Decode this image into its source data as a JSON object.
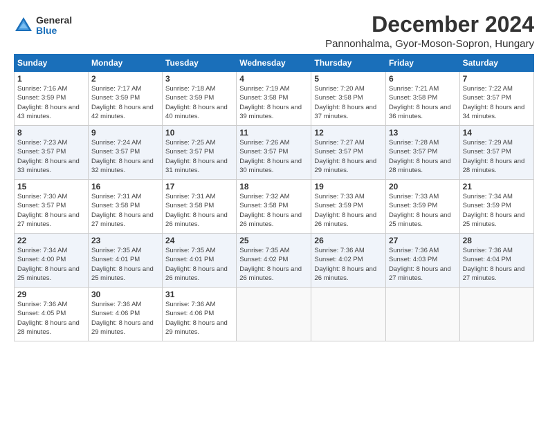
{
  "logo": {
    "general": "General",
    "blue": "Blue"
  },
  "title": "December 2024",
  "subtitle": "Pannonhalma, Gyor-Moson-Sopron, Hungary",
  "days_of_week": [
    "Sunday",
    "Monday",
    "Tuesday",
    "Wednesday",
    "Thursday",
    "Friday",
    "Saturday"
  ],
  "weeks": [
    [
      {
        "day": "1",
        "sunrise": "7:16 AM",
        "sunset": "3:59 PM",
        "daylight": "8 hours and 43 minutes."
      },
      {
        "day": "2",
        "sunrise": "7:17 AM",
        "sunset": "3:59 PM",
        "daylight": "8 hours and 42 minutes."
      },
      {
        "day": "3",
        "sunrise": "7:18 AM",
        "sunset": "3:59 PM",
        "daylight": "8 hours and 40 minutes."
      },
      {
        "day": "4",
        "sunrise": "7:19 AM",
        "sunset": "3:58 PM",
        "daylight": "8 hours and 39 minutes."
      },
      {
        "day": "5",
        "sunrise": "7:20 AM",
        "sunset": "3:58 PM",
        "daylight": "8 hours and 37 minutes."
      },
      {
        "day": "6",
        "sunrise": "7:21 AM",
        "sunset": "3:58 PM",
        "daylight": "8 hours and 36 minutes."
      },
      {
        "day": "7",
        "sunrise": "7:22 AM",
        "sunset": "3:57 PM",
        "daylight": "8 hours and 34 minutes."
      }
    ],
    [
      {
        "day": "8",
        "sunrise": "7:23 AM",
        "sunset": "3:57 PM",
        "daylight": "8 hours and 33 minutes."
      },
      {
        "day": "9",
        "sunrise": "7:24 AM",
        "sunset": "3:57 PM",
        "daylight": "8 hours and 32 minutes."
      },
      {
        "day": "10",
        "sunrise": "7:25 AM",
        "sunset": "3:57 PM",
        "daylight": "8 hours and 31 minutes."
      },
      {
        "day": "11",
        "sunrise": "7:26 AM",
        "sunset": "3:57 PM",
        "daylight": "8 hours and 30 minutes."
      },
      {
        "day": "12",
        "sunrise": "7:27 AM",
        "sunset": "3:57 PM",
        "daylight": "8 hours and 29 minutes."
      },
      {
        "day": "13",
        "sunrise": "7:28 AM",
        "sunset": "3:57 PM",
        "daylight": "8 hours and 28 minutes."
      },
      {
        "day": "14",
        "sunrise": "7:29 AM",
        "sunset": "3:57 PM",
        "daylight": "8 hours and 28 minutes."
      }
    ],
    [
      {
        "day": "15",
        "sunrise": "7:30 AM",
        "sunset": "3:57 PM",
        "daylight": "8 hours and 27 minutes."
      },
      {
        "day": "16",
        "sunrise": "7:31 AM",
        "sunset": "3:58 PM",
        "daylight": "8 hours and 27 minutes."
      },
      {
        "day": "17",
        "sunrise": "7:31 AM",
        "sunset": "3:58 PM",
        "daylight": "8 hours and 26 minutes."
      },
      {
        "day": "18",
        "sunrise": "7:32 AM",
        "sunset": "3:58 PM",
        "daylight": "8 hours and 26 minutes."
      },
      {
        "day": "19",
        "sunrise": "7:33 AM",
        "sunset": "3:59 PM",
        "daylight": "8 hours and 26 minutes."
      },
      {
        "day": "20",
        "sunrise": "7:33 AM",
        "sunset": "3:59 PM",
        "daylight": "8 hours and 25 minutes."
      },
      {
        "day": "21",
        "sunrise": "7:34 AM",
        "sunset": "3:59 PM",
        "daylight": "8 hours and 25 minutes."
      }
    ],
    [
      {
        "day": "22",
        "sunrise": "7:34 AM",
        "sunset": "4:00 PM",
        "daylight": "8 hours and 25 minutes."
      },
      {
        "day": "23",
        "sunrise": "7:35 AM",
        "sunset": "4:01 PM",
        "daylight": "8 hours and 25 minutes."
      },
      {
        "day": "24",
        "sunrise": "7:35 AM",
        "sunset": "4:01 PM",
        "daylight": "8 hours and 26 minutes."
      },
      {
        "day": "25",
        "sunrise": "7:35 AM",
        "sunset": "4:02 PM",
        "daylight": "8 hours and 26 minutes."
      },
      {
        "day": "26",
        "sunrise": "7:36 AM",
        "sunset": "4:02 PM",
        "daylight": "8 hours and 26 minutes."
      },
      {
        "day": "27",
        "sunrise": "7:36 AM",
        "sunset": "4:03 PM",
        "daylight": "8 hours and 27 minutes."
      },
      {
        "day": "28",
        "sunrise": "7:36 AM",
        "sunset": "4:04 PM",
        "daylight": "8 hours and 27 minutes."
      }
    ],
    [
      {
        "day": "29",
        "sunrise": "7:36 AM",
        "sunset": "4:05 PM",
        "daylight": "8 hours and 28 minutes."
      },
      {
        "day": "30",
        "sunrise": "7:36 AM",
        "sunset": "4:06 PM",
        "daylight": "8 hours and 29 minutes."
      },
      {
        "day": "31",
        "sunrise": "7:36 AM",
        "sunset": "4:06 PM",
        "daylight": "8 hours and 29 minutes."
      },
      null,
      null,
      null,
      null
    ]
  ]
}
